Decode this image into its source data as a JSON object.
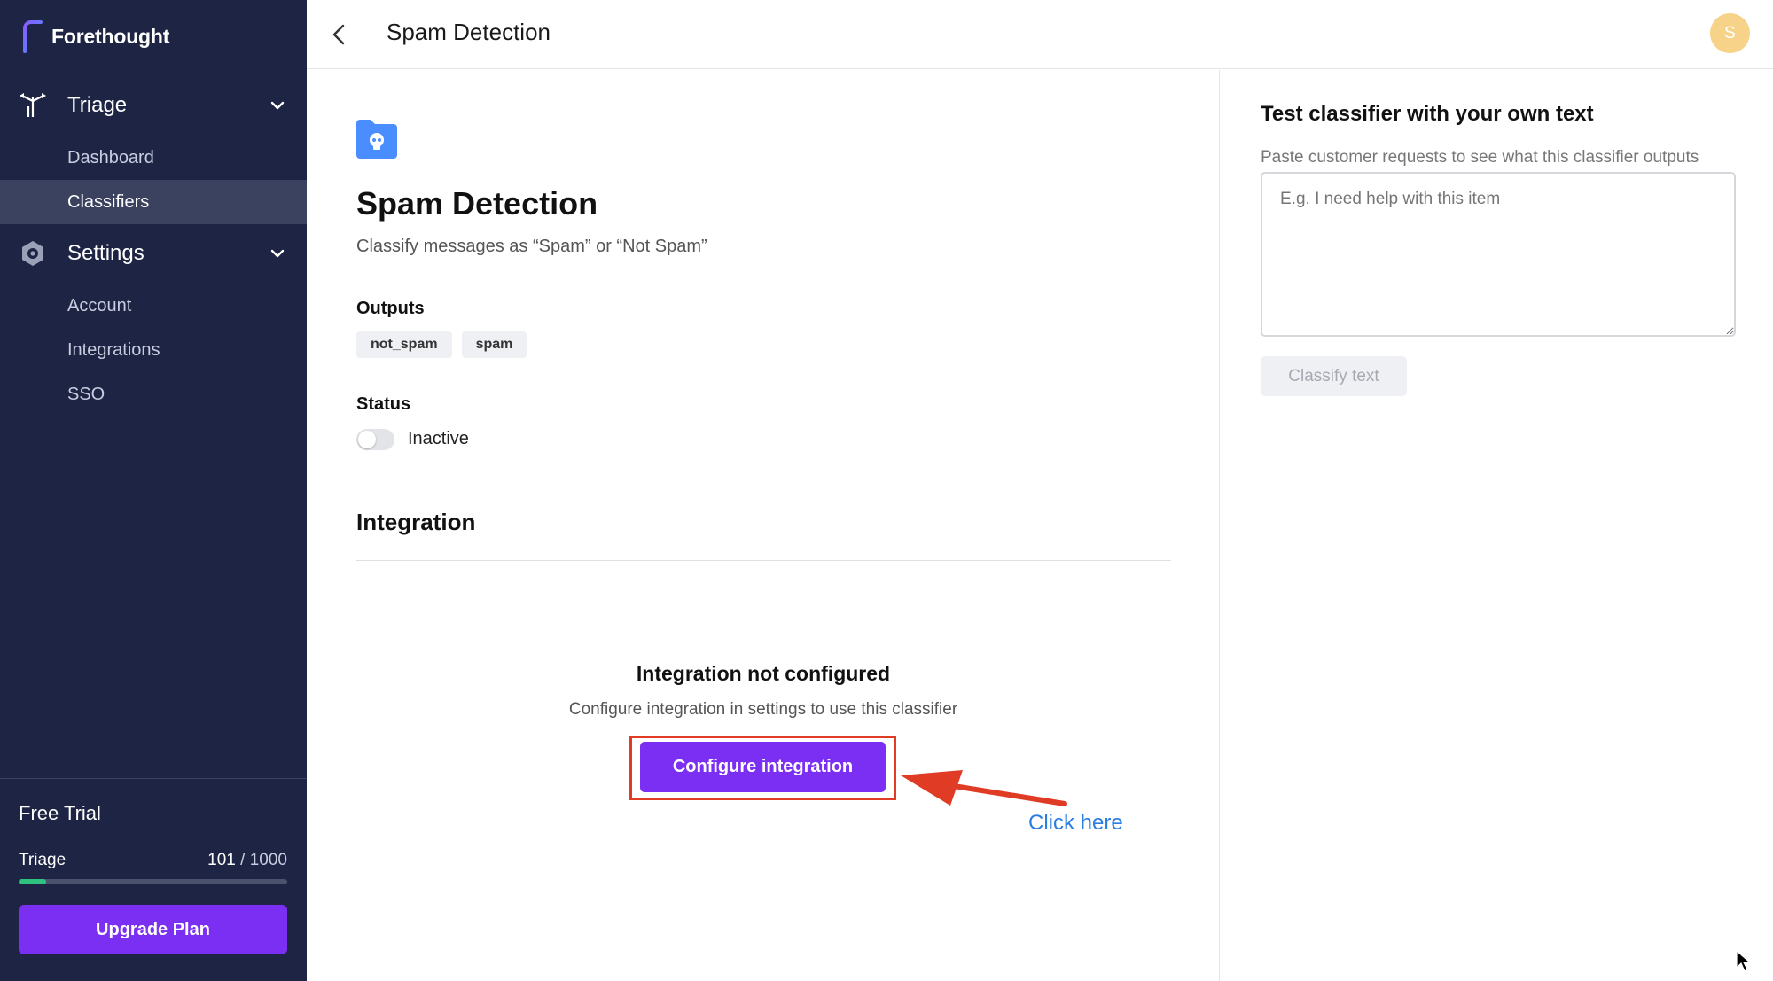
{
  "app": {
    "brand_name": "Forethought",
    "colors": {
      "sidebar_bg": "#1e2544",
      "accent": "#7b2ff2",
      "active_item": "#3a4260",
      "progress": "#2ec27e",
      "highlight": "#e03b24",
      "annotation": "#2a7de1"
    }
  },
  "sidebar": {
    "sections": [
      {
        "label": "Triage",
        "icon": "triage-icon",
        "items": [
          {
            "label": "Dashboard"
          },
          {
            "label": "Classifiers",
            "active": true
          }
        ]
      },
      {
        "label": "Settings",
        "icon": "settings-icon",
        "items": [
          {
            "label": "Account"
          },
          {
            "label": "Integrations"
          },
          {
            "label": "SSO"
          }
        ]
      }
    ],
    "trial": {
      "title": "Free Trial",
      "usage_label": "Triage",
      "used": "101",
      "separator": " / ",
      "limit": "1000",
      "used_fraction": 0.101,
      "upgrade_label": "Upgrade Plan"
    }
  },
  "header": {
    "title": "Spam Detection",
    "back_icon": "chevron-left-icon",
    "avatar_initial": "S"
  },
  "classifier": {
    "icon": "folder-skull-icon",
    "name": "Spam Detection",
    "description": "Classify messages as “Spam” or “Not Spam”",
    "outputs_label": "Outputs",
    "outputs": [
      "not_spam",
      "spam"
    ],
    "status_label": "Status",
    "status_value": "Inactive",
    "status_active": false
  },
  "integration": {
    "heading": "Integration",
    "empty_title": "Integration not configured",
    "empty_desc": "Configure integration in settings to use this classifier",
    "configure_label": "Configure integration",
    "annotation_text": "Click here"
  },
  "test_panel": {
    "title": "Test classifier with your own text",
    "subtitle": "Paste customer requests to see what this classifier outputs",
    "placeholder": "E.g. I need help with this item",
    "classify_label": "Classify text"
  }
}
